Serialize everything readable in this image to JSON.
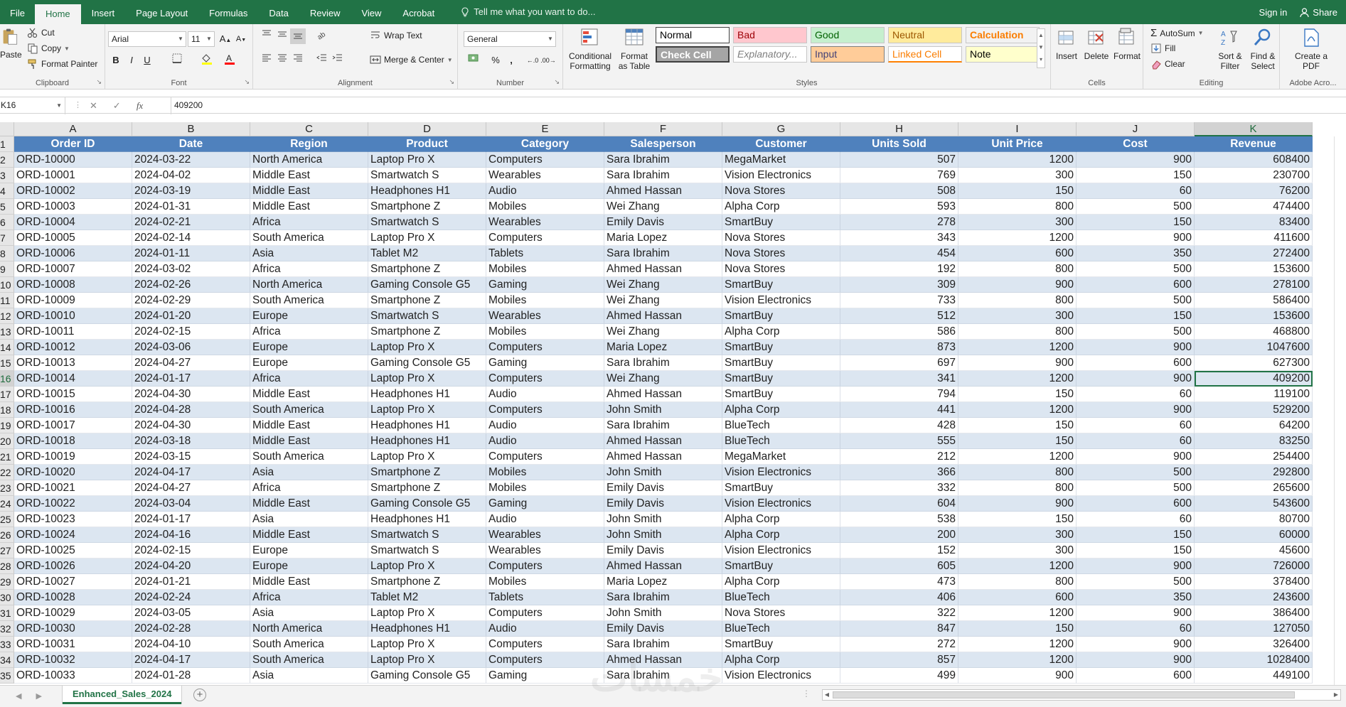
{
  "ribbon_tabs": [
    "File",
    "Home",
    "Insert",
    "Page Layout",
    "Formulas",
    "Data",
    "Review",
    "View",
    "Acrobat"
  ],
  "active_tab": "Home",
  "tell_me": "Tell me what you want to do...",
  "sign_in": "Sign in",
  "share": "Share",
  "clipboard": {
    "paste": "Paste",
    "cut": "Cut",
    "copy": "Copy",
    "format_painter": "Format Painter",
    "label": "Clipboard"
  },
  "font": {
    "name": "Arial",
    "size": "11",
    "bold": "B",
    "italic": "I",
    "underline": "U",
    "grow": "A",
    "shrink": "A",
    "label": "Font"
  },
  "alignment": {
    "wrap_text": "Wrap Text",
    "merge_center": "Merge & Center",
    "label": "Alignment"
  },
  "number": {
    "format": "General",
    "percent": "%",
    "comma": ",",
    "label": "Number"
  },
  "styles": {
    "conditional_formatting": "Conditional Formatting",
    "format_as_table": "Format as Table",
    "label": "Styles",
    "cells": [
      {
        "text": "Normal",
        "bg": "#ffffff",
        "fg": "#000000"
      },
      {
        "text": "Bad",
        "bg": "#ffc7ce",
        "fg": "#9c0006"
      },
      {
        "text": "Good",
        "bg": "#c6efce",
        "fg": "#006100"
      },
      {
        "text": "Neutral",
        "bg": "#ffeb9c",
        "fg": "#9c5700"
      },
      {
        "text": "Calculation",
        "bg": "#f2f2f2",
        "fg": "#fa7d00"
      },
      {
        "text": "Check Cell",
        "bg": "#a5a5a5",
        "fg": "#ffffff"
      },
      {
        "text": "Explanatory...",
        "bg": "#ffffff",
        "fg": "#7f7f7f"
      },
      {
        "text": "Input",
        "bg": "#ffcc99",
        "fg": "#3f3f76"
      },
      {
        "text": "Linked Cell",
        "bg": "#ffffff",
        "fg": "#fa7d00"
      },
      {
        "text": "Note",
        "bg": "#ffffcc",
        "fg": "#000000"
      }
    ]
  },
  "cells_group": {
    "insert": "Insert",
    "delete": "Delete",
    "format": "Format",
    "label": "Cells"
  },
  "editing": {
    "autosum": "AutoSum",
    "fill": "Fill",
    "clear": "Clear",
    "sort_filter": "Sort & Filter",
    "find_select": "Find & Select",
    "label": "Editing"
  },
  "adobe": {
    "create_pdf": "Create a PDF",
    "label": "Adobe Acro..."
  },
  "formula_bar": {
    "name_box": "K16",
    "value": "409200"
  },
  "colors": {
    "excel_green": "#217346",
    "header_blue": "#4f81bd",
    "band_blue": "#dce6f1"
  },
  "sheet": {
    "column_letters": [
      "A",
      "B",
      "C",
      "D",
      "E",
      "F",
      "G",
      "H",
      "I",
      "J",
      "K"
    ],
    "active_cell": "K16",
    "headers": [
      "Order ID",
      "Date",
      "Region",
      "Product",
      "Category",
      "Salesperson",
      "Customer",
      "Units Sold",
      "Unit Price",
      "Cost",
      "Revenue"
    ],
    "rows": [
      [
        "ORD-10000",
        "2024-03-22",
        "North America",
        "Laptop Pro X",
        "Computers",
        "Sara Ibrahim",
        "MegaMarket",
        "507",
        "1200",
        "900",
        "608400"
      ],
      [
        "ORD-10001",
        "2024-04-02",
        "Middle East",
        "Smartwatch S",
        "Wearables",
        "Sara Ibrahim",
        "Vision Electronics",
        "769",
        "300",
        "150",
        "230700"
      ],
      [
        "ORD-10002",
        "2024-03-19",
        "Middle East",
        "Headphones H1",
        "Audio",
        "Ahmed Hassan",
        "Nova Stores",
        "508",
        "150",
        "60",
        "76200"
      ],
      [
        "ORD-10003",
        "2024-01-31",
        "Middle East",
        "Smartphone Z",
        "Mobiles",
        "Wei Zhang",
        "Alpha Corp",
        "593",
        "800",
        "500",
        "474400"
      ],
      [
        "ORD-10004",
        "2024-02-21",
        "Africa",
        "Smartwatch S",
        "Wearables",
        "Emily Davis",
        "SmartBuy",
        "278",
        "300",
        "150",
        "83400"
      ],
      [
        "ORD-10005",
        "2024-02-14",
        "South America",
        "Laptop Pro X",
        "Computers",
        "Maria Lopez",
        "Nova Stores",
        "343",
        "1200",
        "900",
        "411600"
      ],
      [
        "ORD-10006",
        "2024-01-11",
        "Asia",
        "Tablet M2",
        "Tablets",
        "Sara Ibrahim",
        "Nova Stores",
        "454",
        "600",
        "350",
        "272400"
      ],
      [
        "ORD-10007",
        "2024-03-02",
        "Africa",
        "Smartphone Z",
        "Mobiles",
        "Ahmed Hassan",
        "Nova Stores",
        "192",
        "800",
        "500",
        "153600"
      ],
      [
        "ORD-10008",
        "2024-02-26",
        "North America",
        "Gaming Console G5",
        "Gaming",
        "Wei Zhang",
        "SmartBuy",
        "309",
        "900",
        "600",
        "278100"
      ],
      [
        "ORD-10009",
        "2024-02-29",
        "South America",
        "Smartphone Z",
        "Mobiles",
        "Wei Zhang",
        "Vision Electronics",
        "733",
        "800",
        "500",
        "586400"
      ],
      [
        "ORD-10010",
        "2024-01-20",
        "Europe",
        "Smartwatch S",
        "Wearables",
        "Ahmed Hassan",
        "SmartBuy",
        "512",
        "300",
        "150",
        "153600"
      ],
      [
        "ORD-10011",
        "2024-02-15",
        "Africa",
        "Smartphone Z",
        "Mobiles",
        "Wei Zhang",
        "Alpha Corp",
        "586",
        "800",
        "500",
        "468800"
      ],
      [
        "ORD-10012",
        "2024-03-06",
        "Europe",
        "Laptop Pro X",
        "Computers",
        "Maria Lopez",
        "SmartBuy",
        "873",
        "1200",
        "900",
        "1047600"
      ],
      [
        "ORD-10013",
        "2024-04-27",
        "Europe",
        "Gaming Console G5",
        "Gaming",
        "Sara Ibrahim",
        "SmartBuy",
        "697",
        "900",
        "600",
        "627300"
      ],
      [
        "ORD-10014",
        "2024-01-17",
        "Africa",
        "Laptop Pro X",
        "Computers",
        "Wei Zhang",
        "SmartBuy",
        "341",
        "1200",
        "900",
        "409200"
      ],
      [
        "ORD-10015",
        "2024-04-30",
        "Middle East",
        "Headphones H1",
        "Audio",
        "Ahmed Hassan",
        "SmartBuy",
        "794",
        "150",
        "60",
        "119100"
      ],
      [
        "ORD-10016",
        "2024-04-28",
        "South America",
        "Laptop Pro X",
        "Computers",
        "John Smith",
        "Alpha Corp",
        "441",
        "1200",
        "900",
        "529200"
      ],
      [
        "ORD-10017",
        "2024-04-30",
        "Middle East",
        "Headphones H1",
        "Audio",
        "Sara Ibrahim",
        "BlueTech",
        "428",
        "150",
        "60",
        "64200"
      ],
      [
        "ORD-10018",
        "2024-03-18",
        "Middle East",
        "Headphones H1",
        "Audio",
        "Ahmed Hassan",
        "BlueTech",
        "555",
        "150",
        "60",
        "83250"
      ],
      [
        "ORD-10019",
        "2024-03-15",
        "South America",
        "Laptop Pro X",
        "Computers",
        "Ahmed Hassan",
        "MegaMarket",
        "212",
        "1200",
        "900",
        "254400"
      ],
      [
        "ORD-10020",
        "2024-04-17",
        "Asia",
        "Smartphone Z",
        "Mobiles",
        "John Smith",
        "Vision Electronics",
        "366",
        "800",
        "500",
        "292800"
      ],
      [
        "ORD-10021",
        "2024-04-27",
        "Africa",
        "Smartphone Z",
        "Mobiles",
        "Emily Davis",
        "SmartBuy",
        "332",
        "800",
        "500",
        "265600"
      ],
      [
        "ORD-10022",
        "2024-03-04",
        "Middle East",
        "Gaming Console G5",
        "Gaming",
        "Emily Davis",
        "Vision Electronics",
        "604",
        "900",
        "600",
        "543600"
      ],
      [
        "ORD-10023",
        "2024-01-17",
        "Asia",
        "Headphones H1",
        "Audio",
        "John Smith",
        "Alpha Corp",
        "538",
        "150",
        "60",
        "80700"
      ],
      [
        "ORD-10024",
        "2024-04-16",
        "Middle East",
        "Smartwatch S",
        "Wearables",
        "John Smith",
        "Alpha Corp",
        "200",
        "300",
        "150",
        "60000"
      ],
      [
        "ORD-10025",
        "2024-02-15",
        "Europe",
        "Smartwatch S",
        "Wearables",
        "Emily Davis",
        "Vision Electronics",
        "152",
        "300",
        "150",
        "45600"
      ],
      [
        "ORD-10026",
        "2024-04-20",
        "Europe",
        "Laptop Pro X",
        "Computers",
        "Ahmed Hassan",
        "SmartBuy",
        "605",
        "1200",
        "900",
        "726000"
      ],
      [
        "ORD-10027",
        "2024-01-21",
        "Middle East",
        "Smartphone Z",
        "Mobiles",
        "Maria Lopez",
        "Alpha Corp",
        "473",
        "800",
        "500",
        "378400"
      ],
      [
        "ORD-10028",
        "2024-02-24",
        "Africa",
        "Tablet M2",
        "Tablets",
        "Sara Ibrahim",
        "BlueTech",
        "406",
        "600",
        "350",
        "243600"
      ],
      [
        "ORD-10029",
        "2024-03-05",
        "Asia",
        "Laptop Pro X",
        "Computers",
        "John Smith",
        "Nova Stores",
        "322",
        "1200",
        "900",
        "386400"
      ],
      [
        "ORD-10030",
        "2024-02-28",
        "North America",
        "Headphones H1",
        "Audio",
        "Emily Davis",
        "BlueTech",
        "847",
        "150",
        "60",
        "127050"
      ],
      [
        "ORD-10031",
        "2024-04-10",
        "South America",
        "Laptop Pro X",
        "Computers",
        "Sara Ibrahim",
        "SmartBuy",
        "272",
        "1200",
        "900",
        "326400"
      ],
      [
        "ORD-10032",
        "2024-04-17",
        "South America",
        "Laptop Pro X",
        "Computers",
        "Ahmed Hassan",
        "Alpha Corp",
        "857",
        "1200",
        "900",
        "1028400"
      ],
      [
        "ORD-10033",
        "2024-01-28",
        "Asia",
        "Gaming Console G5",
        "Gaming",
        "Sara Ibrahim",
        "Vision Electronics",
        "499",
        "900",
        "600",
        "449100"
      ]
    ]
  },
  "sheet_tab": "Enhanced_Sales_2024",
  "watermark": "خمسات"
}
